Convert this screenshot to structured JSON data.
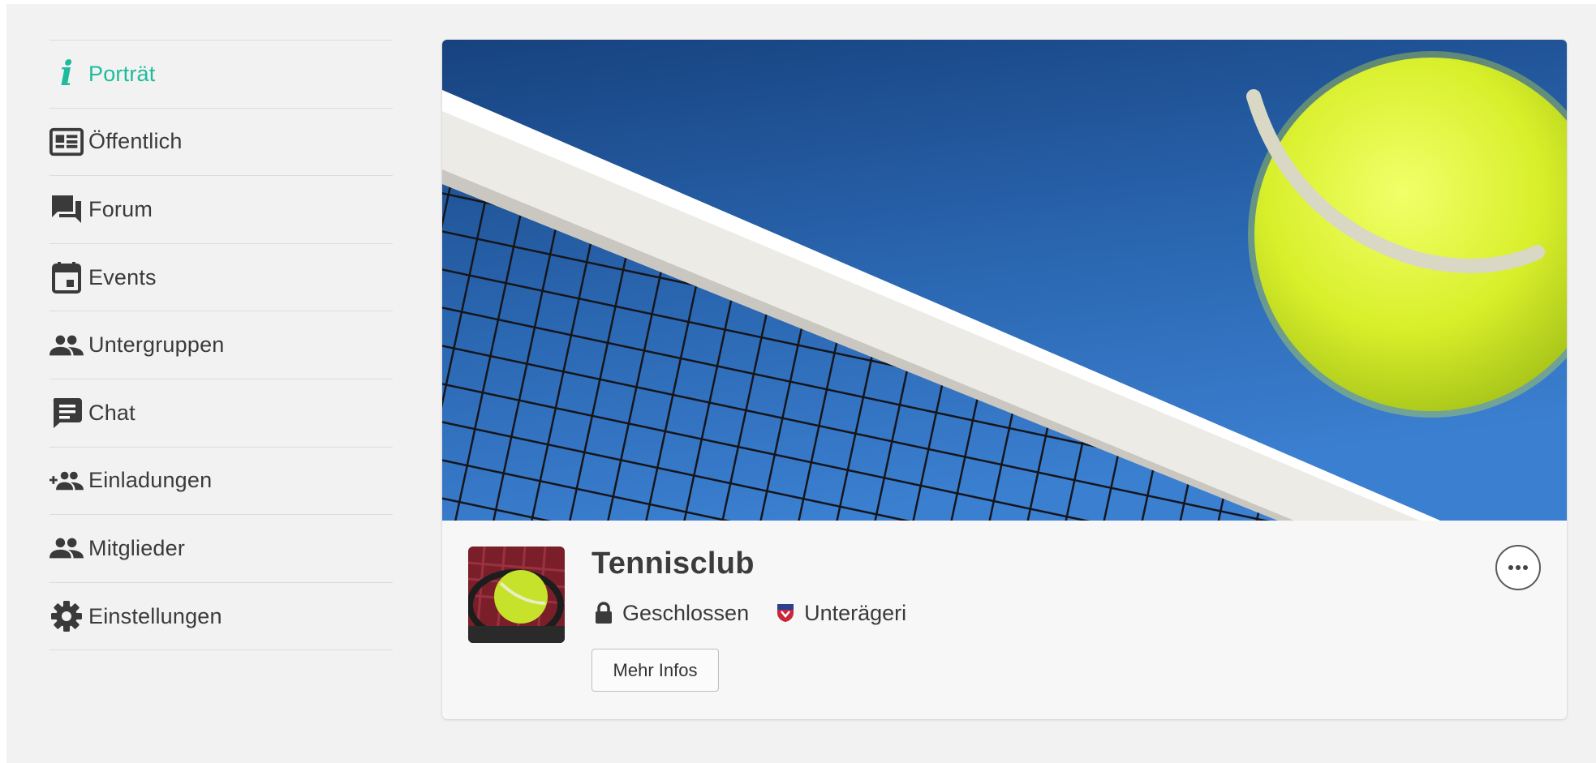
{
  "sidebar": {
    "items": [
      {
        "label": "Porträt",
        "icon": "info-icon",
        "active": true
      },
      {
        "label": "Öffentlich",
        "icon": "newspaper-icon"
      },
      {
        "label": "Forum",
        "icon": "forum-icon"
      },
      {
        "label": "Events",
        "icon": "calendar-icon"
      },
      {
        "label": "Untergruppen",
        "icon": "people-icon"
      },
      {
        "label": "Chat",
        "icon": "chat-icon"
      },
      {
        "label": "Einladungen",
        "icon": "add-people-icon"
      },
      {
        "label": "Mitglieder",
        "icon": "people-icon"
      },
      {
        "label": "Einstellungen",
        "icon": "gear-icon"
      }
    ],
    "info_glyph": "i"
  },
  "group": {
    "title": "Tennisclub",
    "privacy": "Geschlossen",
    "location": "Unterägeri",
    "more_info_label": "Mehr Infos"
  },
  "colors": {
    "accent": "#1ebc9c",
    "page_background": "#f2f2f2",
    "card_background": "#f7f7f7",
    "text": "#3a3a3a"
  }
}
